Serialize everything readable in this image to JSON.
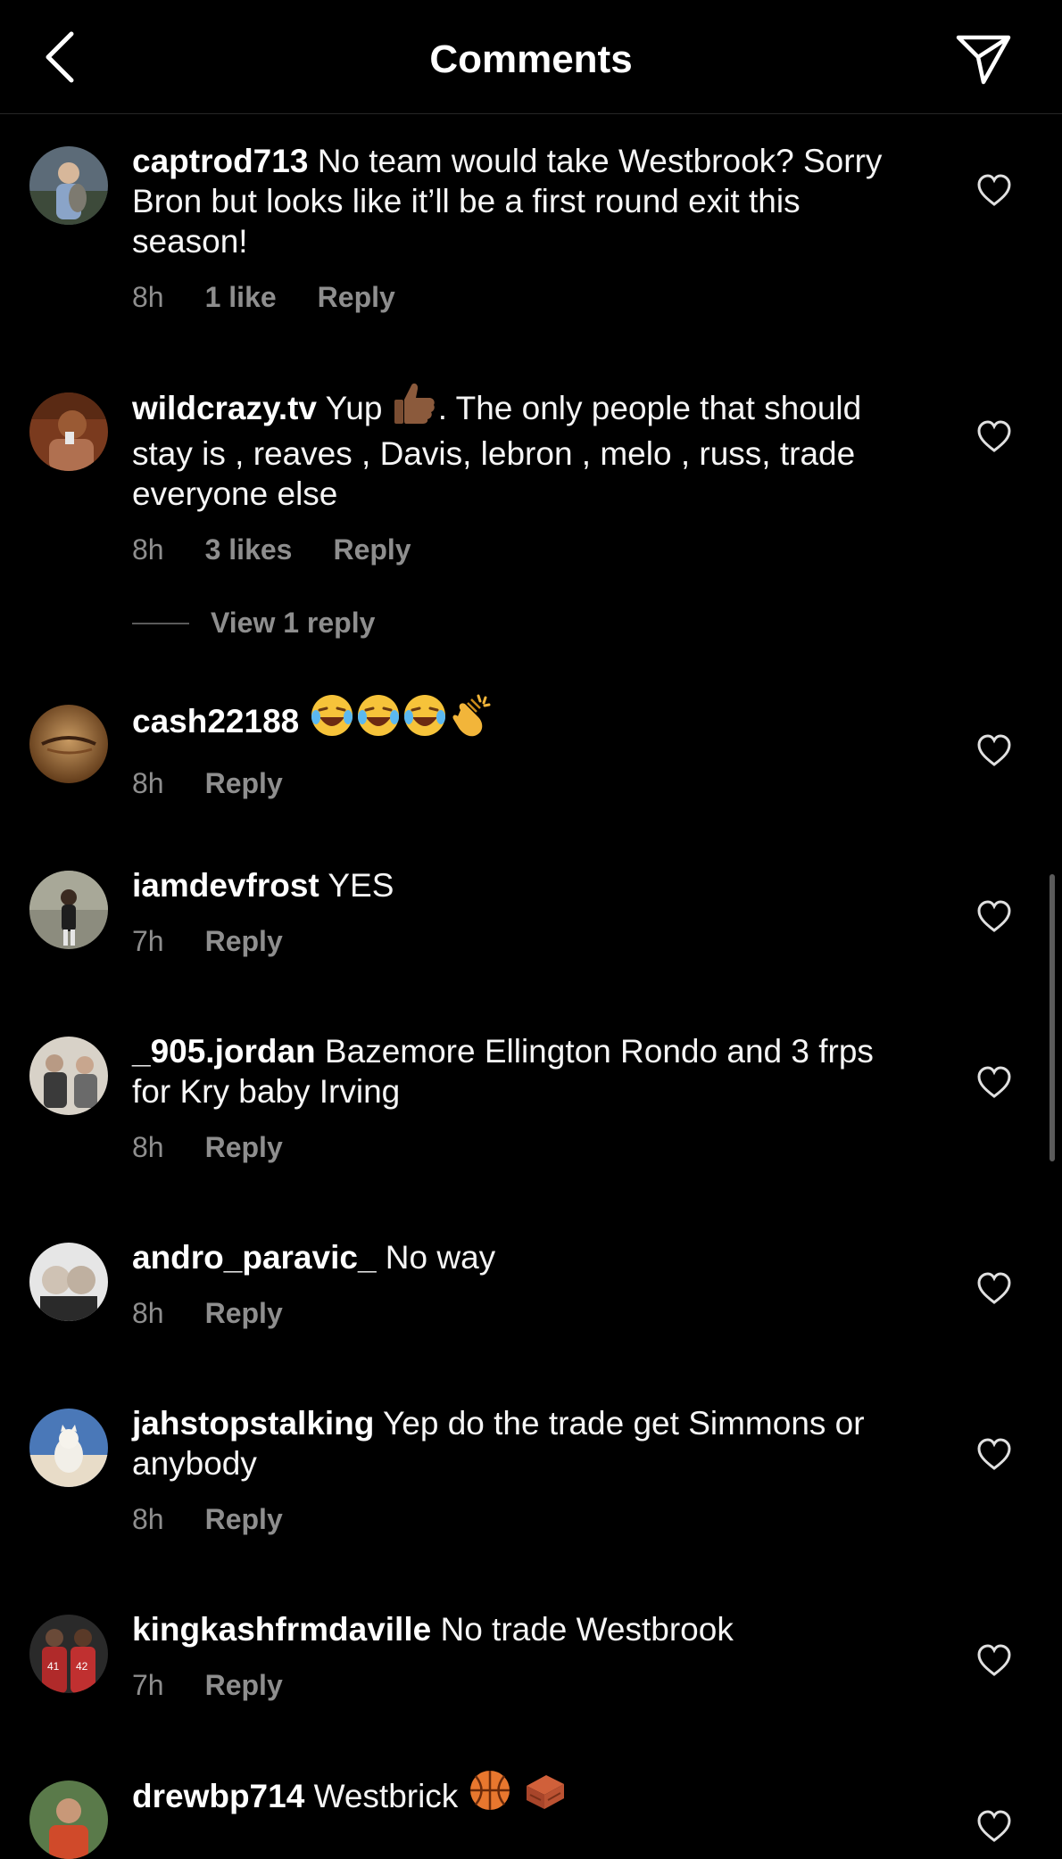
{
  "header": {
    "title": "Comments"
  },
  "comments": [
    {
      "username": "captrod713",
      "text": " No team would take Westbrook? Sorry Bron but looks like it’ll be a first round exit this season!",
      "time": "8h",
      "likes": "1 like",
      "reply": "Reply",
      "avatar_color": "#6d7b8a"
    },
    {
      "username": "wildcrazy.tv",
      "text_before_emoji": " Yup ",
      "text_after_emoji": ". The only people that should stay is , reaves , Davis, lebron , melo , russ,  trade everyone else",
      "emoji": "thumbs-up-icon",
      "time": "8h",
      "likes": "3 likes",
      "reply": "Reply",
      "view_replies": "View 1 reply",
      "avatar_color": "#a0552e"
    },
    {
      "username": "cash22188",
      "emojis": [
        "laughing-tears-icon",
        "laughing-tears-icon",
        "laughing-tears-icon",
        "clapping-hands-icon"
      ],
      "time": "8h",
      "reply": "Reply",
      "avatar_color": "#8a5a2b"
    },
    {
      "username": "iamdevfrost",
      "text": " YES",
      "time": "7h",
      "reply": "Reply",
      "avatar_color": "#9a9a8a"
    },
    {
      "username": "_905.jordan",
      "text": " Bazemore Ellington Rondo and 3 frps for Kry baby Irving",
      "time": "8h",
      "reply": "Reply",
      "avatar_color": "#b7b0a6"
    },
    {
      "username": "andro_paravic_",
      "text": " No way",
      "time": "8h",
      "reply": "Reply",
      "avatar_color": "#c8c8c8"
    },
    {
      "username": "jahstopstalking",
      "text": " Yep do the trade get Simmons or anybody",
      "time": "8h",
      "reply": "Reply",
      "avatar_color": "#5a7fb5"
    },
    {
      "username": "kingkashfrmdaville",
      "text": " No trade Westbrook",
      "time": "7h",
      "reply": "Reply",
      "avatar_color": "#8a2a2a"
    },
    {
      "username": "drewbp714",
      "text": " Westbrick ",
      "emojis": [
        "basketball-icon",
        "brick-icon"
      ],
      "avatar_color": "#6a8a5a"
    }
  ]
}
